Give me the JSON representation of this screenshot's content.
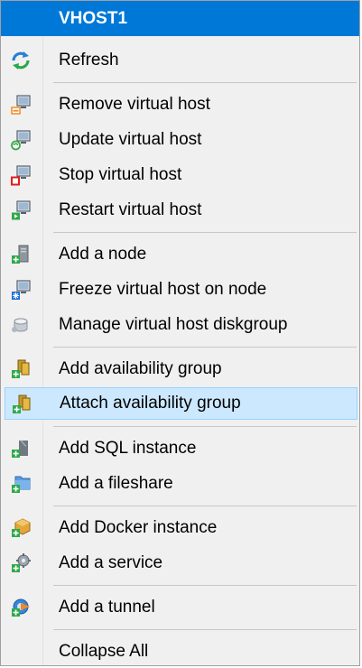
{
  "menu": {
    "title": "VHOST1",
    "items": [
      {
        "label": "Refresh",
        "icon": "refresh-icon"
      },
      {
        "label": "Remove virtual host",
        "icon": "remove-host-icon"
      },
      {
        "label": "Update virtual host",
        "icon": "update-host-icon"
      },
      {
        "label": "Stop virtual host",
        "icon": "stop-host-icon"
      },
      {
        "label": "Restart virtual host",
        "icon": "restart-host-icon"
      },
      {
        "label": "Add a node",
        "icon": "add-node-icon"
      },
      {
        "label": "Freeze virtual host on node",
        "icon": "freeze-host-icon"
      },
      {
        "label": "Manage virtual host diskgroup",
        "icon": "diskgroup-icon"
      },
      {
        "label": "Add availability group",
        "icon": "add-availability-group-icon"
      },
      {
        "label": "Attach availability group",
        "icon": "attach-availability-group-icon"
      },
      {
        "label": "Add SQL instance",
        "icon": "add-sql-instance-icon"
      },
      {
        "label": "Add a fileshare",
        "icon": "add-fileshare-icon"
      },
      {
        "label": "Add Docker instance",
        "icon": "add-docker-instance-icon"
      },
      {
        "label": "Add a service",
        "icon": "add-service-icon"
      },
      {
        "label": "Add a tunnel",
        "icon": "add-tunnel-icon"
      },
      {
        "label": "Collapse All",
        "icon": ""
      }
    ]
  },
  "colors": {
    "title_bg": "#0078d7",
    "highlight_bg": "#cce8ff",
    "highlight_border": "#99d1ff"
  }
}
